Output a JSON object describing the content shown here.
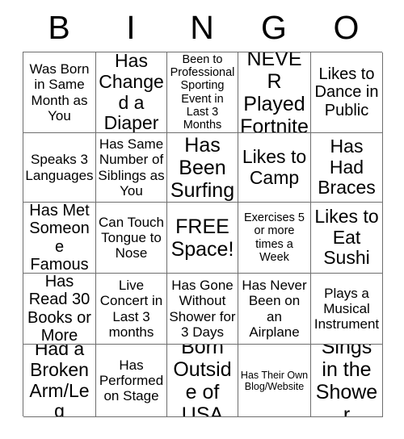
{
  "card": {
    "title": "BINGO",
    "header_letters": [
      "B",
      "I",
      "N",
      "G",
      "O"
    ],
    "border_color": "#6e6e6e",
    "background_color": "#ffffff",
    "text_color": "#000000",
    "columns": 5,
    "rows": 5,
    "free_space_label": "FREE Space!",
    "cells": [
      {
        "text": "Was Born in Same Month as You",
        "size": "md"
      },
      {
        "text": "Has Changed a Diaper",
        "size": "xl"
      },
      {
        "text": "Been to Professional Sporting Event in Last 3 Months",
        "size": "sm"
      },
      {
        "text": "NEVER Played Fortnite",
        "size": "xxl"
      },
      {
        "text": "Likes to Dance in Public",
        "size": "lg"
      },
      {
        "text": "Speaks 3 Languages",
        "size": "md"
      },
      {
        "text": "Has Same Number of Siblings as You",
        "size": "md"
      },
      {
        "text": "Has Been Surfing",
        "size": "xxl"
      },
      {
        "text": "Likes to Camp",
        "size": "xl"
      },
      {
        "text": "Has Had Braces",
        "size": "xl"
      },
      {
        "text": "Has Met Someone Famous",
        "size": "lg"
      },
      {
        "text": "Can Touch Tongue to Nose",
        "size": "md"
      },
      {
        "text": "FREE Space!",
        "size": "xxl"
      },
      {
        "text": "Exercises 5 or more times a Week",
        "size": "sm"
      },
      {
        "text": "Likes to Eat Sushi",
        "size": "xl"
      },
      {
        "text": "Has Read 30 Books or More",
        "size": "lg"
      },
      {
        "text": "Live Concert in Last 3 months",
        "size": "md"
      },
      {
        "text": "Has Gone Without Shower for 3 Days",
        "size": "md"
      },
      {
        "text": "Has Never Been on an Airplane",
        "size": "md"
      },
      {
        "text": "Plays a Musical Instrument",
        "size": "md"
      },
      {
        "text": "Had a Broken Arm/Leg",
        "size": "xl"
      },
      {
        "text": "Has Performed on Stage",
        "size": "md"
      },
      {
        "text": "Born Outside of USA",
        "size": "xxl"
      },
      {
        "text": "Has Their Own Blog/Website",
        "size": "xs"
      },
      {
        "text": "Sings in the Shower",
        "size": "xxl"
      }
    ]
  }
}
